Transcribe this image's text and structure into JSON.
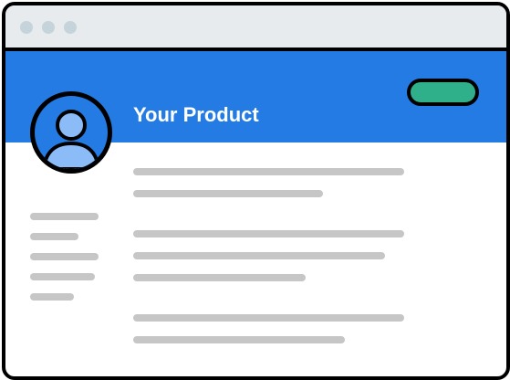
{
  "header": {
    "title": "Your Product"
  },
  "colors": {
    "accent": "#237be3",
    "action_button": "#2fb08a",
    "titlebar": "#e8ebee",
    "window_control": "#c5d4db",
    "placeholder_text": "#c6c6c6",
    "avatar_figure": "#8cbcf8"
  },
  "icons": {
    "avatar": "user-avatar-icon"
  }
}
